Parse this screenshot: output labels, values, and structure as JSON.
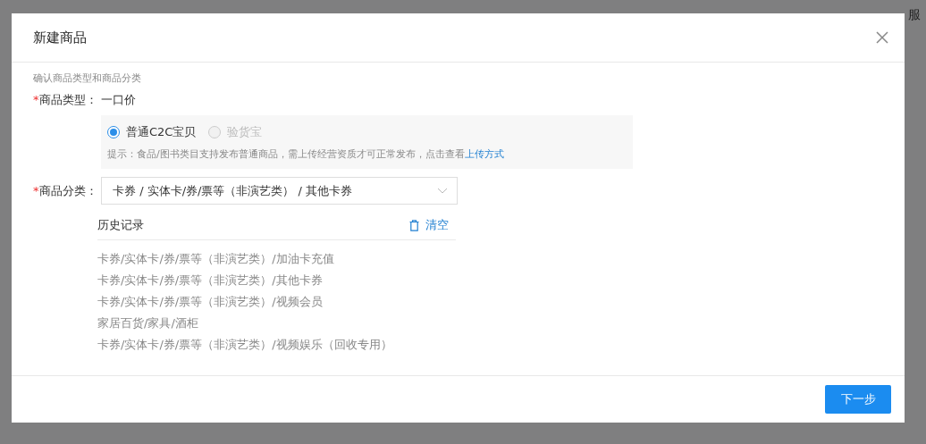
{
  "background": {
    "header_text": "服"
  },
  "dialog": {
    "title": "新建商品",
    "section_hint": "确认商品类型和商品分类",
    "type_field": {
      "label": "商品类型：",
      "required_mark": "*",
      "value": "一口价",
      "options": [
        {
          "label": "普通C2C宝贝",
          "selected": true,
          "disabled": false
        },
        {
          "label": "验货宝",
          "selected": false,
          "disabled": true
        }
      ],
      "tip": "提示：食品/图书类目支持发布普通商品，需上传经营资质才可正常发布，点击查看",
      "tip_link": "上传方式"
    },
    "category_field": {
      "label": "商品分类：",
      "required_mark": "*",
      "value": "卡券 / 实体卡/券/票等（非演艺类） / 其他卡券"
    },
    "history": {
      "title": "历史记录",
      "clear_label": "清空",
      "items": [
        "卡券/实体卡/券/票等（非演艺类）/加油卡充值",
        "卡券/实体卡/券/票等（非演艺类）/其他卡券",
        "卡券/实体卡/券/票等（非演艺类）/视频会员",
        "家居百货/家具/酒柜",
        "卡券/实体卡/券/票等（非演艺类）/视频娱乐（回收专用）"
      ]
    },
    "next_button": "下一步"
  }
}
